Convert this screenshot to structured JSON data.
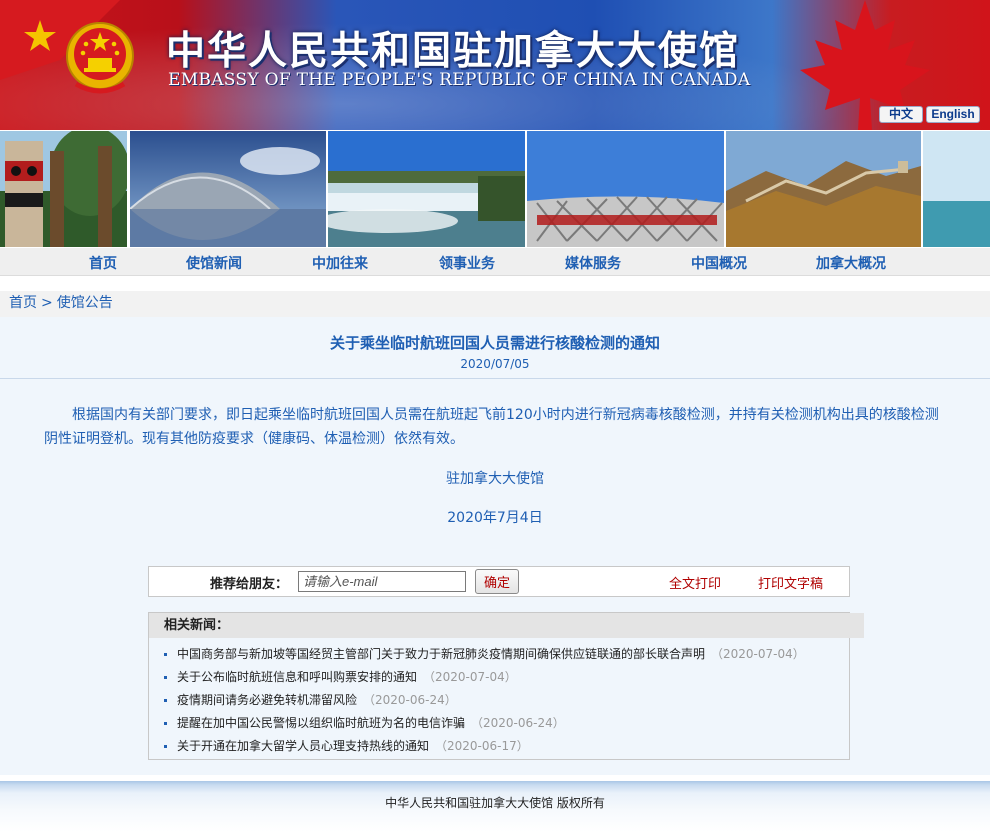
{
  "header": {
    "title_cn": "中华人民共和国驻加拿大大使馆",
    "title_en": "EMBASSY OF THE PEOPLE'S REPUBLIC OF CHINA IN CANADA",
    "lang_cn": "中文",
    "lang_en": "English"
  },
  "nav": [
    "首页",
    "使馆新闻",
    "中加往来",
    "领事业务",
    "媒体服务",
    "中国概况",
    "加拿大概况"
  ],
  "breadcrumb": {
    "home": "首页",
    "sep": ">",
    "section": "使馆公告"
  },
  "article": {
    "title": "关于乘坐临时航班回国人员需进行核酸检测的通知",
    "date": "2020/07/05",
    "body": "根据国内有关部门要求，即日起乘坐临时航班回国人员需在航班起飞前120小时内进行新冠病毒核酸检测，并持有关检测机构出具的核酸检测阴性证明登机。现有其他防疫要求（健康码、体温检测）依然有效。",
    "signature": "驻加拿大大使馆",
    "sign_date": "2020年7月4日"
  },
  "recommend": {
    "label": "推荐给朋友：",
    "placeholder": "请输入e-mail",
    "button": "确定",
    "print_full": "全文打印",
    "print_text": "打印文字稿"
  },
  "related": {
    "heading": "相关新闻：",
    "items": [
      {
        "title": "中国商务部与新加坡等国经贸主管部门关于致力于新冠肺炎疫情期间确保供应链联通的部长联合声明",
        "date": "（2020-07-04）"
      },
      {
        "title": "关于公布临时航班信息和呼叫购票安排的通知",
        "date": "（2020-07-04）"
      },
      {
        "title": "疫情期间请务必避免转机滞留风险",
        "date": "（2020-06-24）"
      },
      {
        "title": "提醒在加中国公民警惕以组织临时航班为名的电信诈骗",
        "date": "（2020-06-24）"
      },
      {
        "title": "关于开通在加拿大留学人员心理支持热线的通知",
        "date": "（2020-06-17）"
      }
    ]
  },
  "footer": {
    "text": "中华人民共和国驻加拿大大使馆 版权所有"
  },
  "colors": {
    "link_blue": "#1f5fb3",
    "accent_red": "#b00000",
    "banner_red": "#c9141a",
    "banner_blue": "#1f4fb3"
  }
}
